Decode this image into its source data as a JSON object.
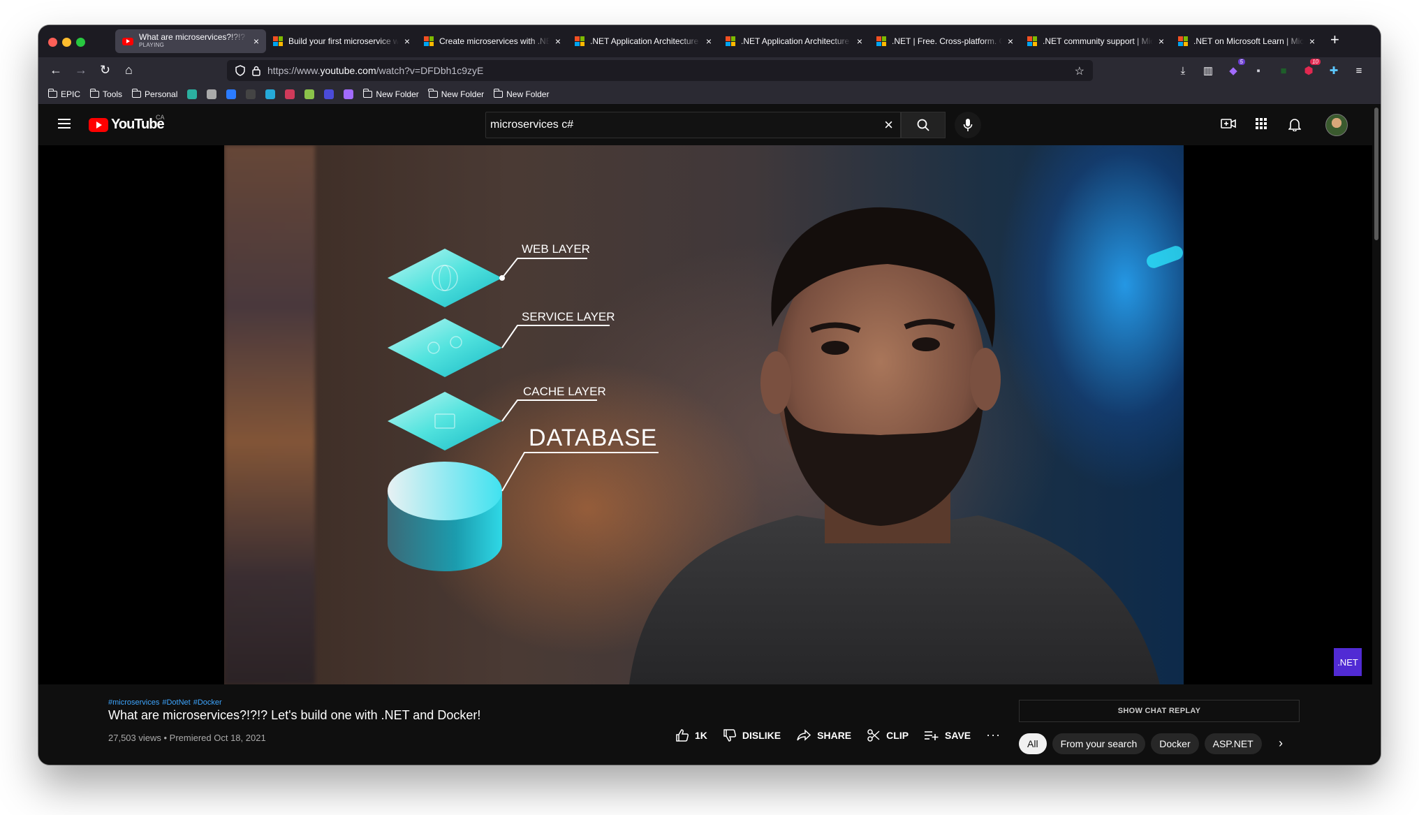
{
  "browser": {
    "tabs": [
      {
        "title": "What are microservices?!?!? Let's build one with .NET and Docker!",
        "subtitle": "PLAYING",
        "favicon": "youtube",
        "active": true
      },
      {
        "title": "Build your first microservice with .NET",
        "favicon": "microsoft",
        "active": false
      },
      {
        "title": "Create microservices with .NET and ASP.NET Core",
        "favicon": "microsoft",
        "active": false
      },
      {
        "title": ".NET Application Architecture Guides",
        "favicon": "microsoft",
        "active": false
      },
      {
        "title": ".NET Application Architecture Guides",
        "favicon": "microsoft",
        "active": false
      },
      {
        "title": ".NET | Free. Cross-platform. Open Source.",
        "favicon": "microsoft",
        "active": false
      },
      {
        "title": ".NET community support | Microsoft",
        "favicon": "microsoft",
        "active": false
      },
      {
        "title": ".NET on Microsoft Learn | Microsoft",
        "favicon": "microsoft",
        "active": false
      }
    ],
    "url_prefix": "https://www.",
    "url_domain": "youtube.com",
    "url_path": "/watch?v=DFDbh1c9zyE",
    "extension_badges": {
      "ext1": "5",
      "ext2": "10"
    },
    "bookmarks": [
      {
        "label": "EPIC",
        "type": "folder"
      },
      {
        "label": "Tools",
        "type": "folder"
      },
      {
        "label": "Personal",
        "type": "folder"
      },
      {
        "label": "",
        "type": "icon",
        "color": "#2bb0a0"
      },
      {
        "label": "",
        "type": "icon",
        "color": "#aaaaaa"
      },
      {
        "label": "",
        "type": "icon",
        "color": "#2b7bff"
      },
      {
        "label": "",
        "type": "icon",
        "color": "#444444"
      },
      {
        "label": "",
        "type": "icon",
        "color": "#25a9d8"
      },
      {
        "label": "",
        "type": "icon",
        "color": "#cf3a5a"
      },
      {
        "label": "",
        "type": "icon",
        "color": "#8bc34a"
      },
      {
        "label": "",
        "type": "icon",
        "color": "#4b4bd8"
      },
      {
        "label": "",
        "type": "icon",
        "color": "#a26bff"
      },
      {
        "label": "New Folder",
        "type": "folder"
      },
      {
        "label": "New Folder",
        "type": "folder"
      },
      {
        "label": "New Folder",
        "type": "folder"
      }
    ]
  },
  "youtube": {
    "logo_text": "YouTube",
    "region": "CA",
    "search_query": "microservices c#",
    "video_overlay": {
      "labels": [
        "WEB LAYER",
        "SERVICE LAYER",
        "CACHE LAYER",
        "DATABASE"
      ],
      "corner_badge": ".NET"
    },
    "video": {
      "hashtags": [
        "#microservices",
        "#DotNet",
        "#Docker"
      ],
      "title": "What are microservices?!?!? Let's build one with .NET and Docker!",
      "meta": "27,503 views • Premiered Oct 18, 2021",
      "likes": "1K",
      "dislike_label": "DISLIKE",
      "share_label": "SHARE",
      "clip_label": "CLIP",
      "save_label": "SAVE"
    },
    "chat_replay_label": "SHOW CHAT REPLAY",
    "chips": [
      "All",
      "From your search",
      "Docker",
      "ASP.NET"
    ]
  },
  "colors": {
    "yt_red": "#ff0000",
    "link_blue": "#3ea6ff",
    "dotnet_purple": "#512bd4",
    "cyan_layer": "#3fe0e0"
  }
}
